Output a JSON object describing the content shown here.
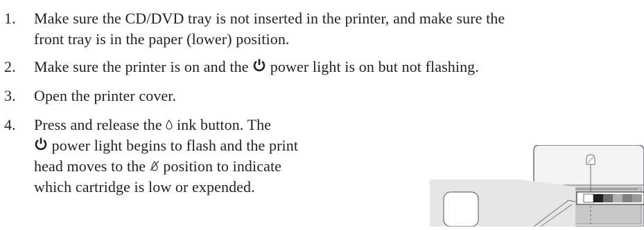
{
  "steps": [
    {
      "number": "1.",
      "lines": [
        "Make sure the CD/DVD tray is not inserted in the printer, and make sure the",
        "front tray is in the paper (lower) position."
      ]
    },
    {
      "number": "2.",
      "before": "Make sure the printer is on and the",
      "icon": "power-icon",
      "after": "power light is on but not flashing."
    },
    {
      "number": "3.",
      "text": "Open the printer cover."
    },
    {
      "number": "4.",
      "line1_before": "Press and release the",
      "line1_icon": "ink-drop-icon",
      "line1_after": "ink button. The",
      "line2_icon": "power-icon",
      "line2_after": "power light begins to flash and the print",
      "line3_before": "head moves to the",
      "line3_icon": "ink-out-icon",
      "line3_after": "position to indicate",
      "line4": "which cartridge is low or expended."
    }
  ],
  "colors": {
    "text": "#231f20",
    "illustration_stroke": "#6d6e71",
    "illustration_fill": "#d9d9d9"
  }
}
